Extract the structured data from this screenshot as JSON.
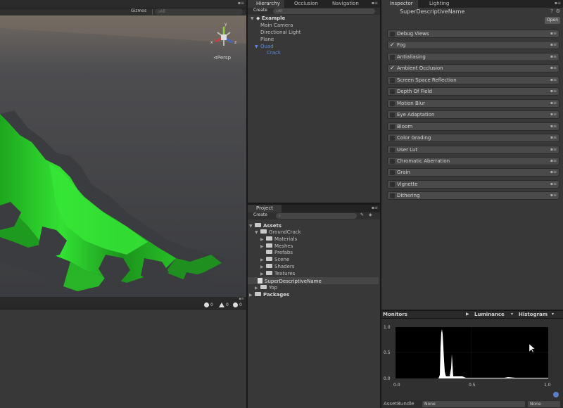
{
  "scene": {
    "gizmos": "Gizmos",
    "search_placeholder": "All",
    "persp": "Persp",
    "axis_x": "x",
    "axis_y": "y",
    "axis_z": "z"
  },
  "console": {
    "info_count": "0",
    "warn_count": "0",
    "error_count": "0"
  },
  "hierarchy": {
    "tabs": [
      "Hierarchy",
      "Occlusion",
      "Navigation"
    ],
    "create": "Create",
    "search_placeholder": "All",
    "scene_name": "Example",
    "items": [
      "Main Camera",
      "Directional Light",
      "Plane",
      "Quad",
      "Crack"
    ]
  },
  "project": {
    "tab": "Project",
    "create": "Create",
    "items": [
      "Assets",
      "GroundCrack",
      "Materials",
      "Meshes",
      "Prefabs",
      "Scene",
      "Shaders",
      "Textures",
      "SuperDescriptiveName",
      "Yop",
      "Packages"
    ]
  },
  "inspector": {
    "tabs": [
      "Inspector",
      "Lighting"
    ],
    "title": "SuperDescriptiveName",
    "open": "Open",
    "effects": [
      {
        "label": "Debug Views",
        "checked": false
      },
      {
        "label": "Fog",
        "checked": true
      },
      {
        "label": "Antialiasing",
        "checked": false
      },
      {
        "label": "Ambient Occlusion",
        "checked": true
      },
      {
        "label": "Screen Space Reflection",
        "checked": false
      },
      {
        "label": "Depth Of Field",
        "checked": false
      },
      {
        "label": "Motion Blur",
        "checked": false
      },
      {
        "label": "Eye Adaptation",
        "checked": false
      },
      {
        "label": "Bloom",
        "checked": false
      },
      {
        "label": "Color Grading",
        "checked": false
      },
      {
        "label": "User Lut",
        "checked": false
      },
      {
        "label": "Chromatic Aberration",
        "checked": false
      },
      {
        "label": "Grain",
        "checked": false
      },
      {
        "label": "Vignette",
        "checked": false
      },
      {
        "label": "Dithering",
        "checked": false
      }
    ]
  },
  "monitors": {
    "title": "Monitors",
    "mode": "Luminance",
    "view": "Histogram",
    "y_ticks": [
      "1.0",
      "0.5",
      "0.0"
    ],
    "x_ticks": [
      "0.0",
      "0.5",
      "1.0"
    ]
  },
  "asset_bundle": {
    "label": "AssetBundle",
    "name_value": "None",
    "variant_value": "None"
  },
  "colors": {
    "crack_green": "#2dd12d",
    "selection_blue": "#5a8ae0",
    "panel_bg": "#383838"
  }
}
